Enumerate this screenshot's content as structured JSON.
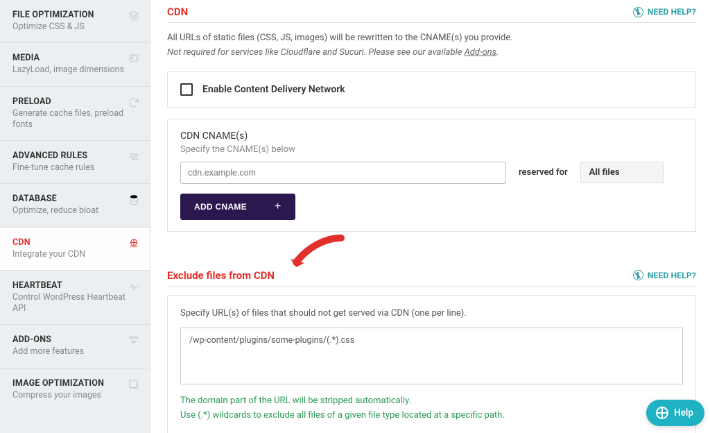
{
  "sidebar": {
    "items": [
      {
        "title": "FILE OPTIMIZATION",
        "sub": "Optimize CSS & JS"
      },
      {
        "title": "MEDIA",
        "sub": "LazyLoad, image dimensions"
      },
      {
        "title": "PRELOAD",
        "sub": "Generate cache files, preload fonts"
      },
      {
        "title": "ADVANCED RULES",
        "sub": "Fine-tune cache rules"
      },
      {
        "title": "DATABASE",
        "sub": "Optimize, reduce bloat"
      },
      {
        "title": "CDN",
        "sub": "Integrate your CDN"
      },
      {
        "title": "HEARTBEAT",
        "sub": "Control WordPress Heartbeat API"
      },
      {
        "title": "ADD-ONS",
        "sub": "Add more features"
      },
      {
        "title": "IMAGE OPTIMIZATION",
        "sub": "Compress your images"
      }
    ]
  },
  "cdn": {
    "title": "CDN",
    "need_help": "NEED HELP?",
    "desc1": "All URLs of static files (CSS, JS, images) will be rewritten to the CNAME(s) you provide.",
    "desc2_prefix": "Not required for services like Cloudflare and Sucuri. Please see our available ",
    "desc2_link": "Add-ons",
    "desc2_suffix": ".",
    "enable_label": "Enable Content Delivery Network",
    "cname_title": "CDN CNAME(s)",
    "cname_sub": "Specify the CNAME(s) below",
    "cname_placeholder": "cdn.example.com",
    "reserved_label": "reserved for",
    "reserved_value": "All files",
    "add_btn": "ADD CNAME"
  },
  "exclude": {
    "title": "Exclude files from CDN",
    "need_help": "NEED HELP?",
    "desc": "Specify URL(s) of files that should not get served via CDN (one per line).",
    "textarea_value": "/wp-content/plugins/some-plugins/(.*).css",
    "hint1": "The domain part of the URL will be stripped automatically.",
    "hint2": "Use (.*) wildcards to exclude all files of a given file type located at a specific path."
  },
  "fab": {
    "label": "Help"
  }
}
